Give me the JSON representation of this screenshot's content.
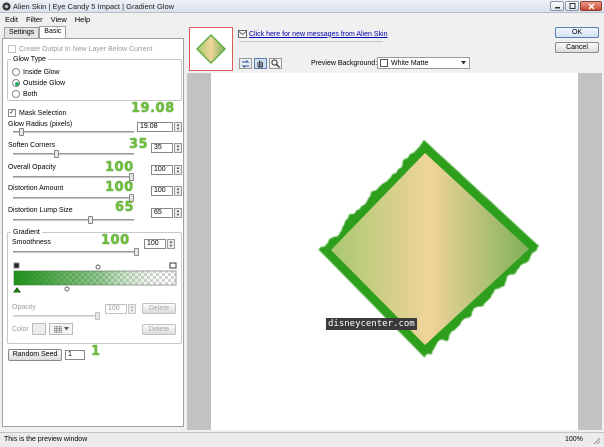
{
  "window": {
    "title": "Alien Skin | Eye Candy 5 Impact | Gradient Glow",
    "controls": [
      "minimize",
      "maximize",
      "close"
    ]
  },
  "menu": [
    "Edit",
    "Filter",
    "View",
    "Help"
  ],
  "tabs": [
    "Settings",
    "Basic"
  ],
  "settings": {
    "create_output_label": "Create Output In New Layer Below Current",
    "glow_type": {
      "legend": "Glow Type",
      "options": [
        "Inside Glow",
        "Outside Glow",
        "Both"
      ],
      "selected": "Outside Glow"
    },
    "mask_selection_label": "Mask Selection",
    "glow_radius": {
      "label": "Glow Radius (pixels)",
      "value": "19.08",
      "annotation": "19.08",
      "level": 0.05
    },
    "soften_corners": {
      "label": "Soften Corners",
      "value": "35",
      "annotation": "35",
      "level": 0.35
    },
    "overall_opacity": {
      "label": "Overall Opacity",
      "value": "100",
      "annotation": "100",
      "level": 1.0
    },
    "distortion_amount": {
      "label": "Distortion Amount",
      "value": "100",
      "annotation": "100",
      "level": 1.0
    },
    "distortion_lump_size": {
      "label": "Distortion Lump Size",
      "value": "65",
      "annotation": "65",
      "level": 0.65
    },
    "gradient": {
      "legend": "Gradient",
      "smoothness_label": "Smoothness",
      "smoothness_value": "100",
      "smoothness_annotation": "100",
      "smoothness_level": 1.0,
      "color_start": "#1f8f1a",
      "color_end": "#ffffff",
      "opacity_label": "Opacity",
      "opacity_value": "100",
      "delete_label": "Delete",
      "color_label": "Color"
    },
    "random_seed": {
      "label": "Random Seed",
      "value": "1",
      "annotation": "1"
    }
  },
  "header": {
    "message_link": "Click here for new messages from Alien Skin",
    "ok_label": "OK",
    "cancel_label": "Cancel",
    "preview_background_label": "Preview Background:",
    "preview_background_value": "White Matte",
    "tool_icons": [
      "hand-pan-icon",
      "magnifier-icon",
      "swap-icon"
    ]
  },
  "preview": {
    "watermark": "disneycenter.com",
    "shape_gradient": [
      "#a9c870",
      "#f0d49a",
      "#7fb05a"
    ],
    "glow_color": "#2e9f1e"
  },
  "status": {
    "text": "This is the preview window",
    "zoom": "100%"
  },
  "colors": {
    "annotation_green": "#6bbf3a",
    "thumbnail_border": "#e05a5a"
  }
}
